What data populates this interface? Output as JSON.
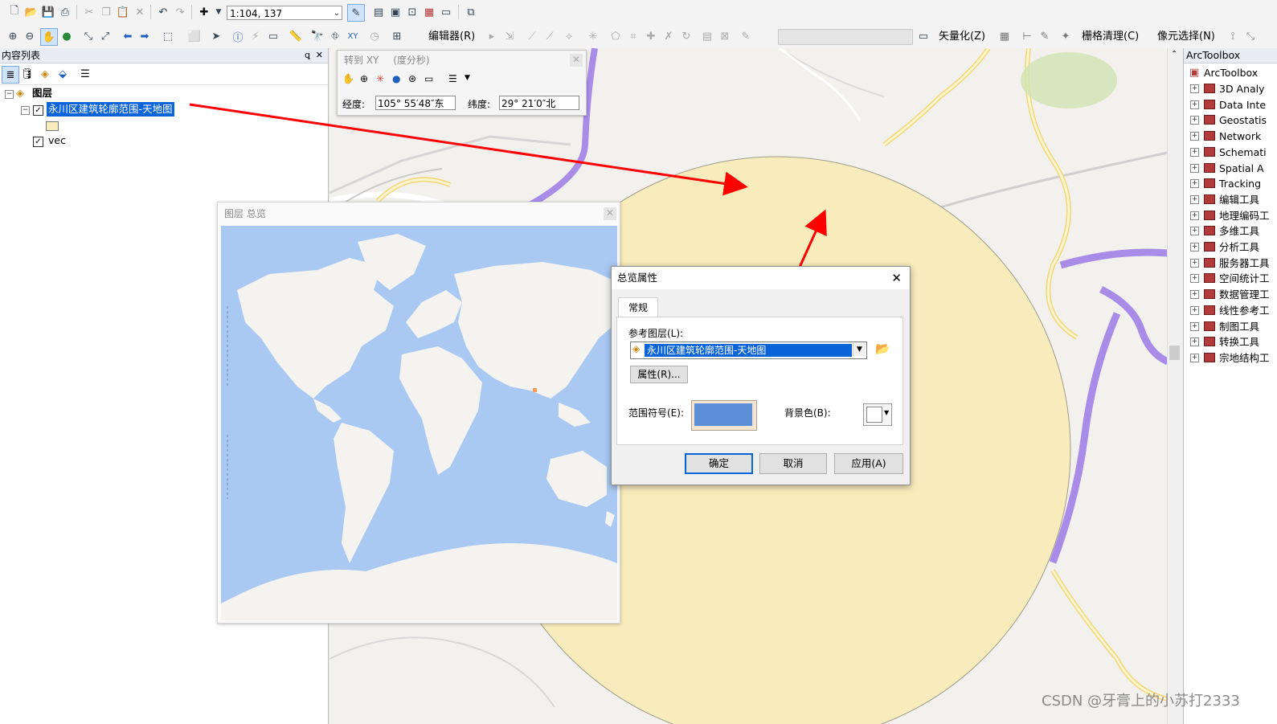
{
  "toolbar": {
    "scale_value": "1:104, 137",
    "editor_label": "编辑器(R)",
    "vectorize_label": "矢量化(Z)",
    "raster_cleanup_label": "栅格清理(C)",
    "cell_select_label": "像元选择(N)"
  },
  "toc": {
    "title": "内容列表",
    "pin": "ꝗ",
    "close": "✕",
    "root_label": "图层",
    "layers": [
      {
        "label": "永川区建筑轮廓范围-天地图",
        "checked": true,
        "selected": true
      },
      {
        "label": "vec",
        "checked": true,
        "selected": false
      }
    ]
  },
  "goto_xy": {
    "title": "转到 XY",
    "units": "(度分秒)",
    "longitude_label": "经度:",
    "longitude_value": "105° 55′48″东",
    "latitude_label": "纬度:",
    "latitude_value": "29° 21′0″北"
  },
  "overview_window": {
    "title": "图层 总览"
  },
  "overview_dialog": {
    "title": "总览属性",
    "tab_general": "常规",
    "ref_layer_label": "参考图层(L):",
    "ref_layer_value": "永川区建筑轮廓范围-天地图",
    "properties_button": "属性(R)...",
    "extent_symbol_label": "范围符号(E):",
    "background_label": "背景色(B):",
    "ok": "确定",
    "cancel": "取消",
    "apply": "应用(A)",
    "close": "✕",
    "extent_color": "#5b8fd8"
  },
  "arctoolbox": {
    "title": "ArcToolbox",
    "root": "ArcToolbox",
    "items": [
      "3D Analy",
      "Data Inte",
      "Geostatis",
      "Network",
      "Schemati",
      "Spatial A",
      "Tracking",
      "编辑工具",
      "地理编码工",
      "多维工具",
      "分析工具",
      "服务器工具",
      "空间统计工",
      "数据管理工",
      "线性参考工",
      "制图工具",
      "转换工具",
      "宗地结构工"
    ]
  },
  "watermark": "CSDN @牙膏上的小苏打2333",
  "colors": {
    "buffer_fill": "#f8ecbc",
    "arrow": "#ff0000",
    "selection": "#0a64d8",
    "ocean": "#aac9f2",
    "land": "#f4f3ef"
  }
}
